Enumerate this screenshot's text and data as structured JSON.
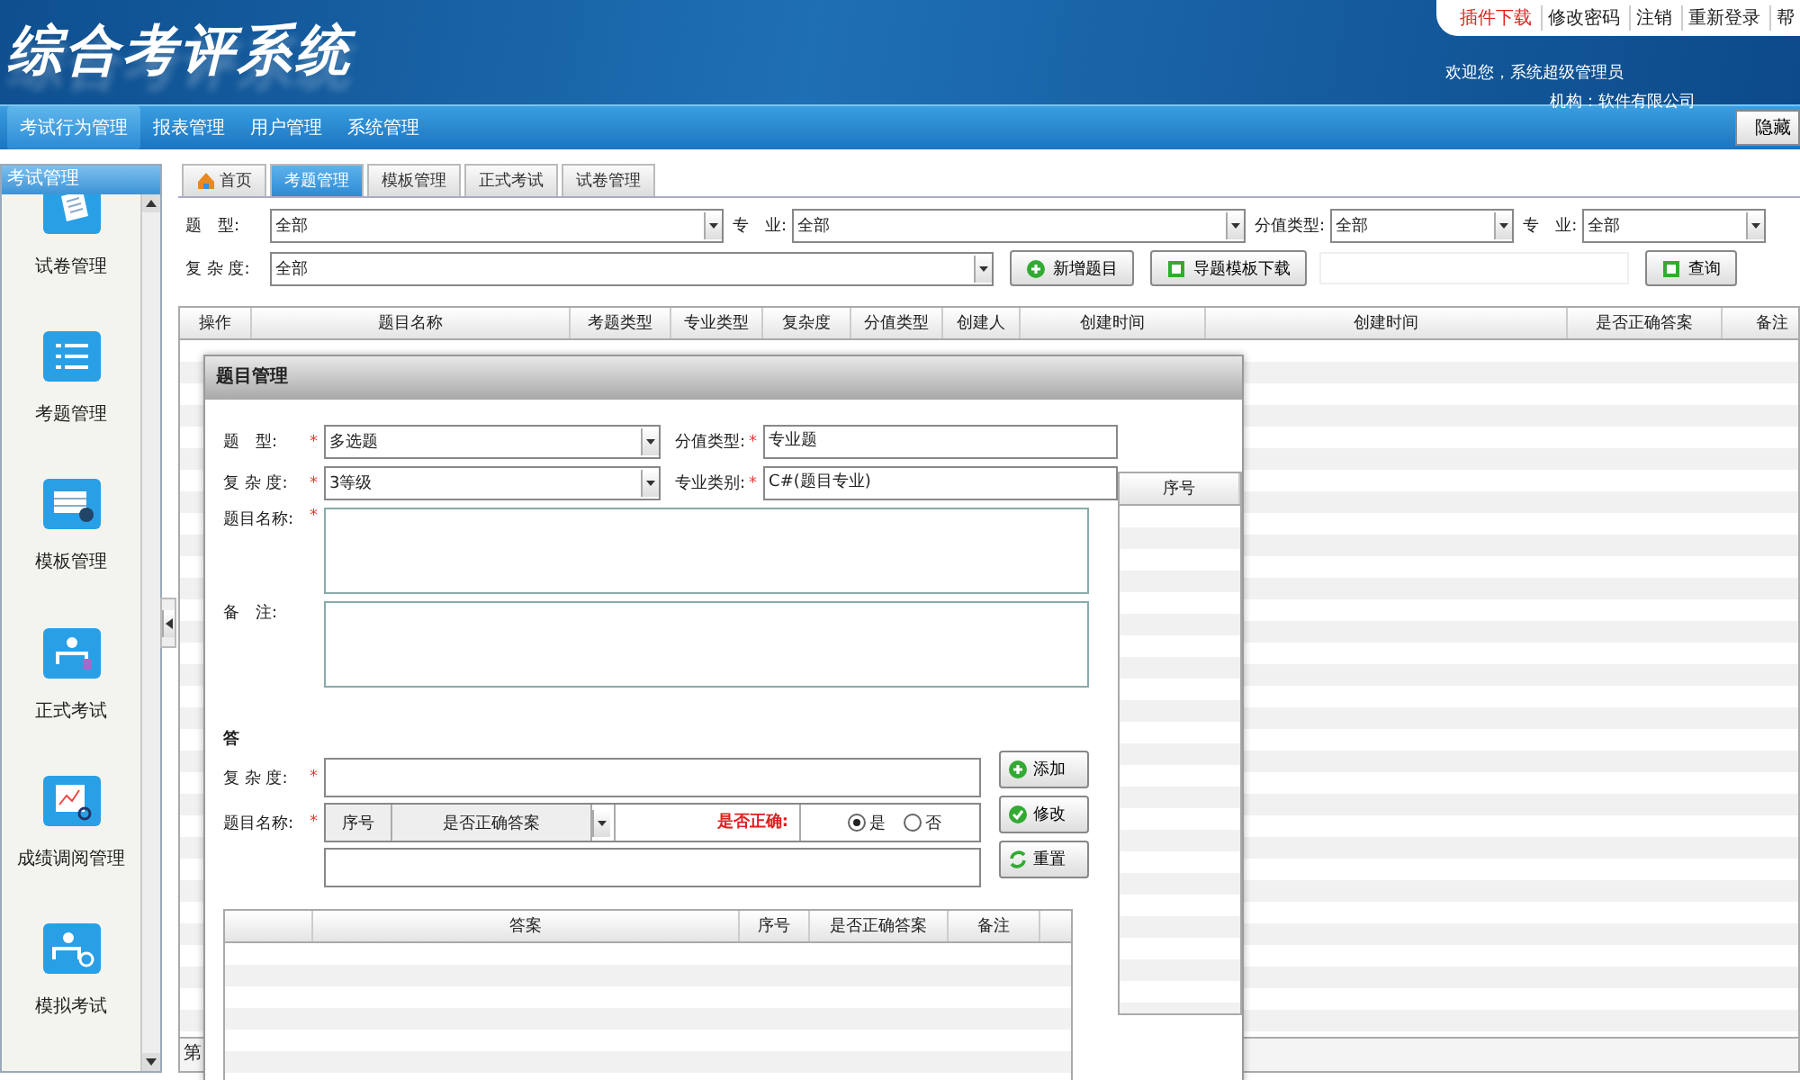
{
  "header": {
    "logo": "综合考评系统",
    "links": [
      {
        "label": "插件下载",
        "kind": "highlight"
      },
      {
        "label": "修改密码",
        "kind": "plain"
      },
      {
        "label": "注销",
        "kind": "plain"
      },
      {
        "label": "重新登录",
        "kind": "plain"
      },
      {
        "label": "帮",
        "kind": "plain"
      }
    ],
    "welcome": "欢迎您，系统超级管理员",
    "org": "机构：软件有限公司"
  },
  "nav": {
    "items": [
      {
        "label": "考试行为管理",
        "selected": true
      },
      {
        "label": "报表管理",
        "selected": false
      },
      {
        "label": "用户管理",
        "selected": false
      },
      {
        "label": "系统管理",
        "selected": false
      }
    ],
    "hide_button": "隐藏"
  },
  "sidebar": {
    "title": "考试管理",
    "items": [
      {
        "label": "试卷管理",
        "kind": "paper"
      },
      {
        "label": "考题管理",
        "kind": "list"
      },
      {
        "label": "模板管理",
        "kind": "form"
      },
      {
        "label": "正式考试",
        "kind": "person"
      },
      {
        "label": "成绩调阅管理",
        "kind": "chart"
      },
      {
        "label": "模拟考试",
        "kind": "clock"
      }
    ]
  },
  "tabs": [
    {
      "label": "首页",
      "kind": "home",
      "selected": false
    },
    {
      "label": "考题管理",
      "kind": "plain",
      "selected": true
    },
    {
      "label": "模板管理",
      "kind": "plain",
      "selected": false
    },
    {
      "label": "正式考试",
      "kind": "plain",
      "selected": false
    },
    {
      "label": "试卷管理",
      "kind": "plain",
      "selected": false
    }
  ],
  "filters": [
    {
      "label": "题　型:",
      "value": "全部",
      "kind": "select"
    },
    {
      "label": "专　业:",
      "value": "全部",
      "kind": "select"
    },
    {
      "label": "分值类型:",
      "value": "全部",
      "kind": "select"
    },
    {
      "label": "专　业:",
      "value": "全部",
      "kind": "select"
    },
    {
      "label": "复 杂 度:",
      "value": "全部",
      "kind": "select"
    }
  ],
  "actions": [
    {
      "label": "新增题目",
      "kind": "add"
    },
    {
      "label": "导题模板下载",
      "kind": "download"
    },
    {
      "label": "查询",
      "kind": "search"
    }
  ],
  "table": {
    "columns": [
      "操作",
      "题目名称",
      "考题类型",
      "专业类型",
      "复杂度",
      "分值类型",
      "创建人",
      "创建时间",
      "创建时间",
      "是否正确答案",
      "备注"
    ],
    "footer": "第"
  },
  "dialog": {
    "title": "题目管理",
    "required_mark": "*",
    "fields": [
      {
        "label": "题　型:",
        "value": "多选题",
        "kind": "select"
      },
      {
        "label": "分值类型:",
        "value": "专业题",
        "kind": "input"
      },
      {
        "label": "复 杂 度:",
        "value": "3等级",
        "kind": "select"
      },
      {
        "label": "专业类别:",
        "value": "C#(题目专业)",
        "kind": "input"
      }
    ],
    "name_label": "题目名称:",
    "name_required": true,
    "note_label": "备　注:",
    "note_required": false,
    "side_column": "序号",
    "answer": {
      "section": "答",
      "complexity_label": "复 杂 度:",
      "name_label": "题目名称:",
      "mini_columns": [
        "序号",
        "是否正确答案"
      ],
      "correct_label": "是否正确:",
      "options": [
        {
          "label": "是",
          "selected": true
        },
        {
          "label": "否",
          "selected": false
        }
      ],
      "buttons": [
        {
          "label": "添加",
          "kind": "add"
        },
        {
          "label": "修改",
          "kind": "edit"
        },
        {
          "label": "重置",
          "kind": "reset"
        }
      ],
      "columns": [
        "答案",
        "序号",
        "是否正确答案",
        "备注"
      ]
    }
  }
}
